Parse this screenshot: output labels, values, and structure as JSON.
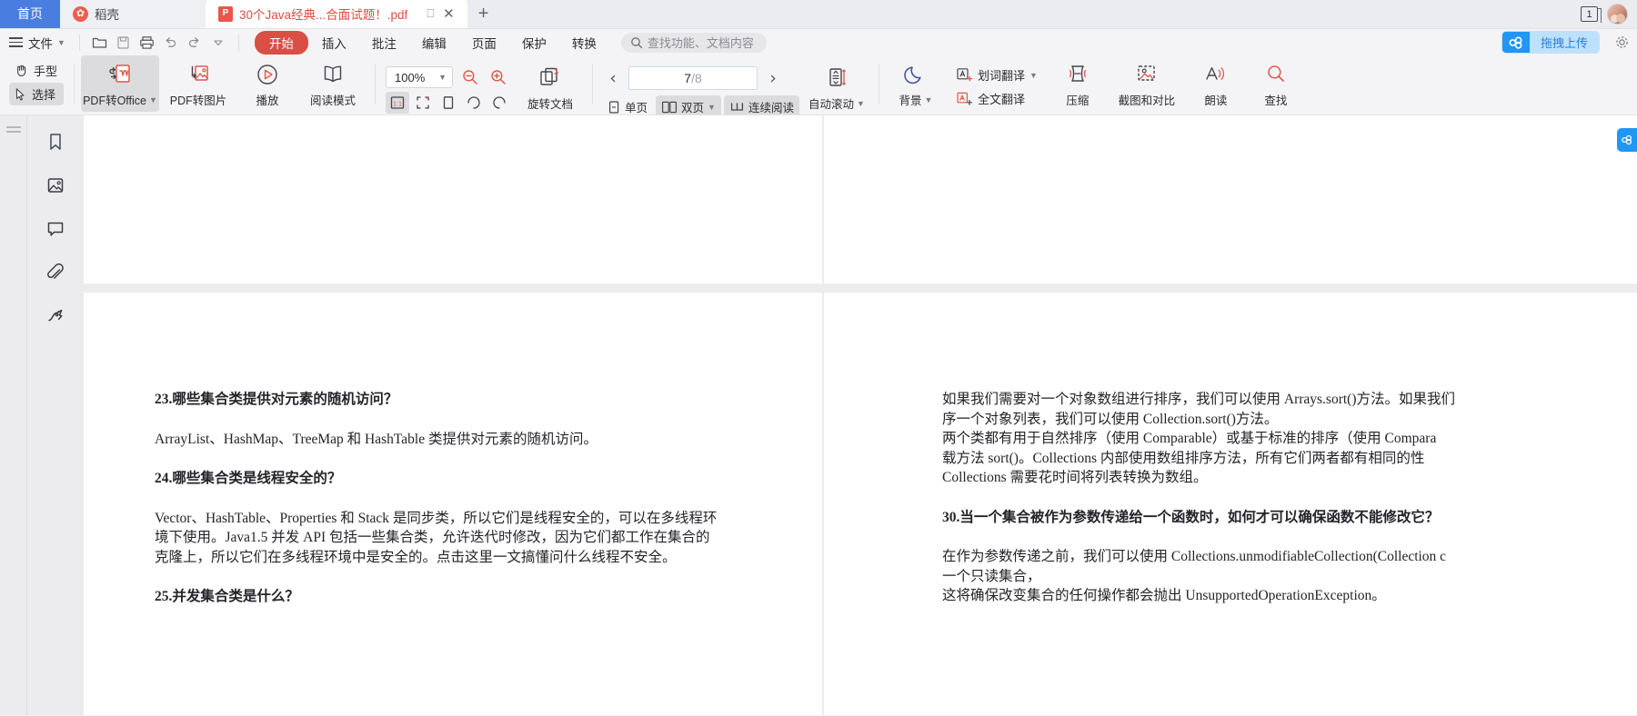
{
  "tabs": {
    "home_label": "首页",
    "docer_label": "稻壳",
    "docer_icon": "docer-logo-icon",
    "active_label": "30个Java经典...合面试题！.pdf",
    "active_icon": "pdf-file-icon",
    "screen_icon": "screen-cast-icon",
    "close_icon": "close-icon",
    "new_tab_icon": "plus-icon",
    "window_count": "1",
    "avatar": "user-avatar"
  },
  "menu": {
    "hamburger_icon": "hamburger-menu-icon",
    "file_label": "文件",
    "file_caret": "chevron-down-icon",
    "quick": [
      {
        "name": "open-folder-icon"
      },
      {
        "name": "save-icon"
      },
      {
        "name": "print-icon"
      },
      {
        "name": "undo-icon"
      },
      {
        "name": "redo-icon"
      },
      {
        "name": "customize-toolbar-caret-icon"
      }
    ],
    "items": [
      {
        "label": "开始",
        "active": true
      },
      {
        "label": "插入",
        "active": false
      },
      {
        "label": "批注",
        "active": false
      },
      {
        "label": "编辑",
        "active": false
      },
      {
        "label": "页面",
        "active": false
      },
      {
        "label": "保护",
        "active": false
      },
      {
        "label": "转换",
        "active": false
      }
    ],
    "search_placeholder": "查找功能、文档内容",
    "search_icon": "search-icon",
    "cloud_upload_label": "拖拽上传",
    "cloud_icon": "cloud-drive-icon",
    "settings_icon": "gear-icon"
  },
  "ribbon": {
    "hand_label": "手型",
    "hand_icon": "hand-tool-icon",
    "select_label": "选择",
    "select_icon": "cursor-select-icon",
    "pdf_to_office_label": "PDF转Office",
    "pdf_to_office_icon": "pdf-to-word-icon",
    "pdf_to_image_label": "PDF转图片",
    "pdf_to_image_icon": "pdf-to-image-icon",
    "play_label": "播放",
    "play_icon": "play-circle-icon",
    "read_mode_label": "阅读模式",
    "read_mode_icon": "open-book-icon",
    "zoom_value": "100%",
    "zoom_caret": "chevron-down-icon",
    "zoom_out_icon": "zoom-out-icon",
    "zoom_in_icon": "zoom-in-icon",
    "fit_actual_icon": "actual-size-icon",
    "fit_page_icon": "fit-page-icon",
    "fit_width_icon": "fit-width-icon",
    "rotate_left_icon": "rotate-left-icon",
    "rotate_right_icon": "rotate-right-icon",
    "rotate_doc_label": "旋转文档",
    "rotate_doc_icon": "rotate-document-icon",
    "prev_page_icon": "chevron-left-icon",
    "next_page_icon": "chevron-right-icon",
    "page_current": "7",
    "page_total": "/8",
    "single_page_label": "单页",
    "single_page_icon": "single-page-icon",
    "double_page_label": "双页",
    "double_page_icon": "double-page-icon",
    "double_page_caret": "chevron-down-icon",
    "continuous_label": "连续阅读",
    "continuous_icon": "continuous-scroll-icon",
    "autoscroll_label": "自动滚动",
    "autoscroll_icon": "auto-scroll-icon",
    "autoscroll_caret": "chevron-down-icon",
    "background_label": "背景",
    "background_icon": "moon-icon",
    "background_caret": "chevron-down-icon",
    "word_translate_label": "划词翻译",
    "word_translate_icon": "word-translate-icon",
    "word_translate_caret": "chevron-down-icon",
    "full_translate_label": "全文翻译",
    "full_translate_icon": "full-translate-icon",
    "compress_label": "压缩",
    "compress_icon": "compress-icon",
    "screenshot_compare_label": "截图和对比",
    "screenshot_compare_icon": "screenshot-compare-icon",
    "read_aloud_label": "朗读",
    "read_aloud_icon": "read-aloud-icon",
    "find_label": "查找",
    "find_icon": "search-icon"
  },
  "sidebar": {
    "grip_icon": "panel-grip-icon",
    "items": [
      {
        "name": "bookmark-icon"
      },
      {
        "name": "thumbnail-image-icon"
      },
      {
        "name": "comment-icon"
      },
      {
        "name": "attachment-icon"
      },
      {
        "name": "signature-icon"
      }
    ]
  },
  "document": {
    "cloud_side_icon": "cloud-drive-side-icon",
    "left_page": [
      {
        "type": "q",
        "text": "23.哪些集合类提供对元素的随机访问？"
      },
      {
        "type": "p",
        "lines": [
          "ArrayList、HashMap、TreeMap 和 HashTable 类提供对元素的随机访问。"
        ]
      },
      {
        "type": "q",
        "text": "24.哪些集合类是线程安全的？"
      },
      {
        "type": "p",
        "lines": [
          "Vector、HashTable、Properties 和 Stack 是同步类，所以它们是线程安全的，可以在多线程环",
          "境下使用。Java1.5 并发 API 包括一些集合类，允许迭代时修改，因为它们都工作在集合的",
          "克隆上，所以它们在多线程环境中是安全的。点击这里一文搞懂问什么线程不安全。"
        ]
      },
      {
        "type": "q",
        "text": "25.并发集合类是什么？"
      }
    ],
    "right_page": [
      {
        "type": "p",
        "lines": [
          "如果我们需要对一个对象数组进行排序，我们可以使用 Arrays.sort()方法。如果我们",
          "序一个对象列表，我们可以使用 Collection.sort()方法。"
        ]
      },
      {
        "type": "p",
        "lines": [
          "两个类都有用于自然排序（使用 Comparable）或基于标准的排序（使用 Compara",
          "载方法 sort()。Collections 内部使用数组排序方法，所有它们两者都有相同的性",
          "Collections 需要花时间将列表转换为数组。"
        ]
      },
      {
        "type": "q",
        "text": "30.当一个集合被作为参数传递给一个函数时，如何才可以确保函数不能修改它？"
      },
      {
        "type": "p",
        "lines": [
          "在作为参数传递之前，我们可以使用 Collections.unmodifiableCollection(Collection c",
          "一个只读集合，",
          "这将确保改变集合的任何操作都会抛出 UnsupportedOperationException。"
        ]
      }
    ]
  },
  "colors": {
    "accent_red": "#d94f45",
    "tab_blue": "#4a7de0",
    "cloud_blue": "#2196f3",
    "chrome_bg": "#f4f4f6",
    "doc_bg": "#ececee"
  }
}
